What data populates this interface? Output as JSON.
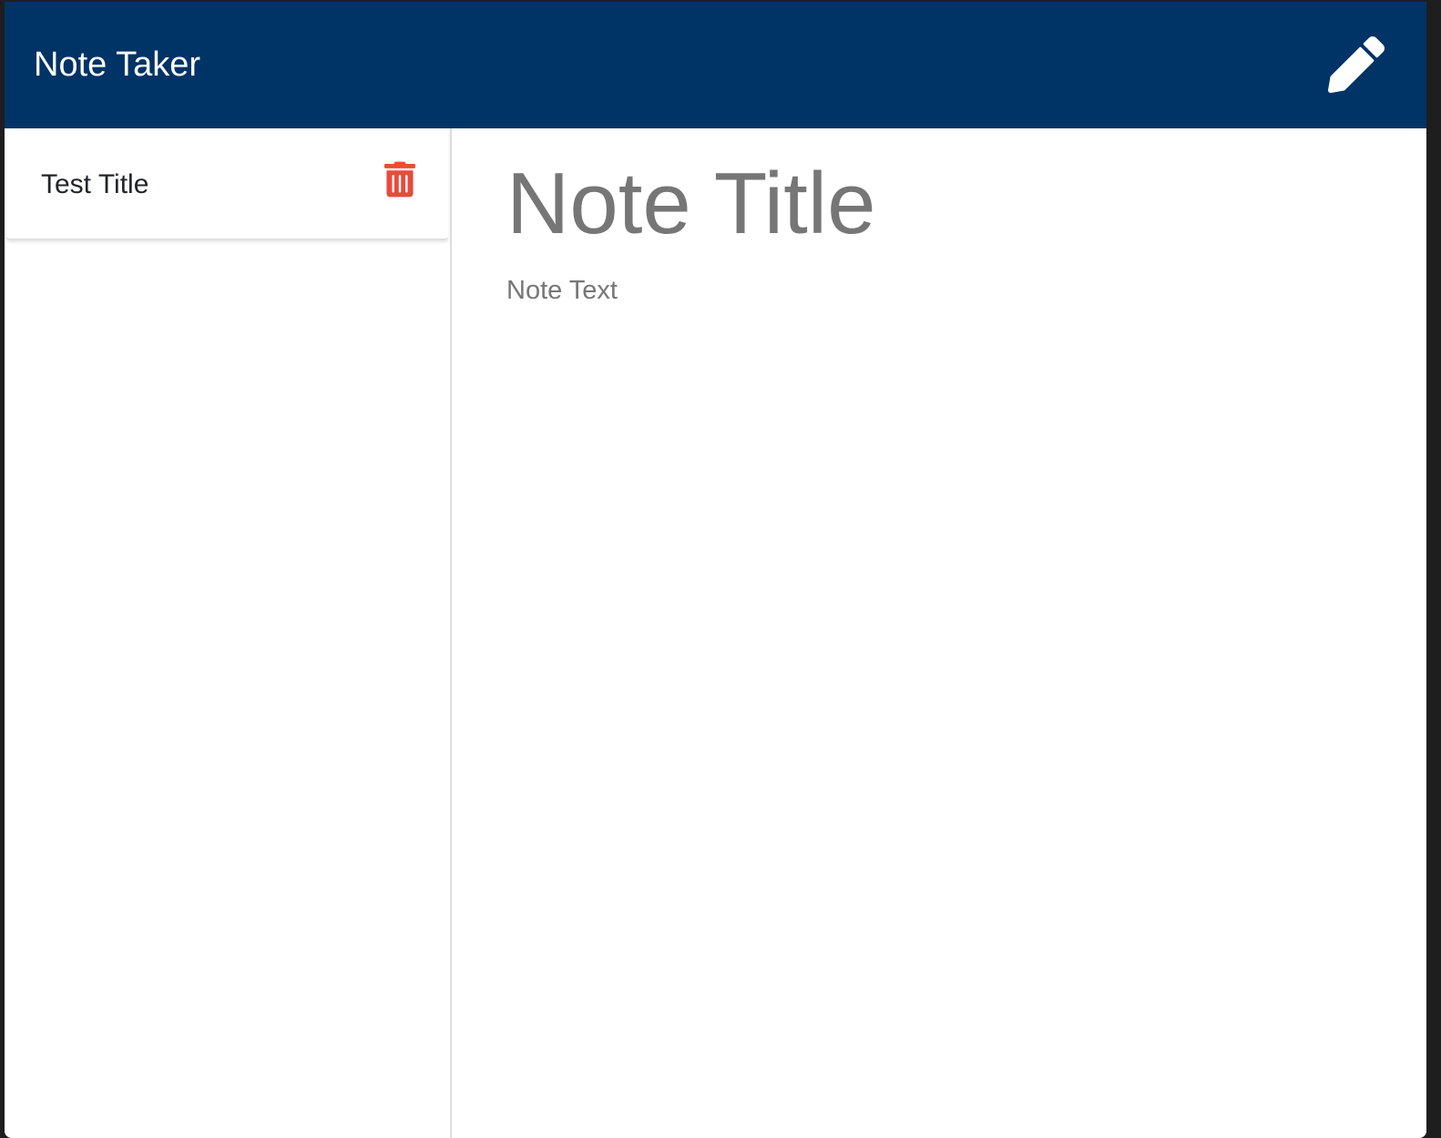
{
  "app": {
    "brand": "Note Taker"
  },
  "toolbar": {
    "new_note_icon": "pencil-icon"
  },
  "sidebar": {
    "notes": [
      {
        "title": "Test Title",
        "delete_icon": "trash-icon"
      }
    ]
  },
  "editor": {
    "title_placeholder": "Note Title",
    "text_placeholder": "Note Text",
    "title_value": "",
    "text_value": ""
  },
  "colors": {
    "navbar": "#003366",
    "delete": "#e74c3c",
    "placeholder": "#767676"
  }
}
